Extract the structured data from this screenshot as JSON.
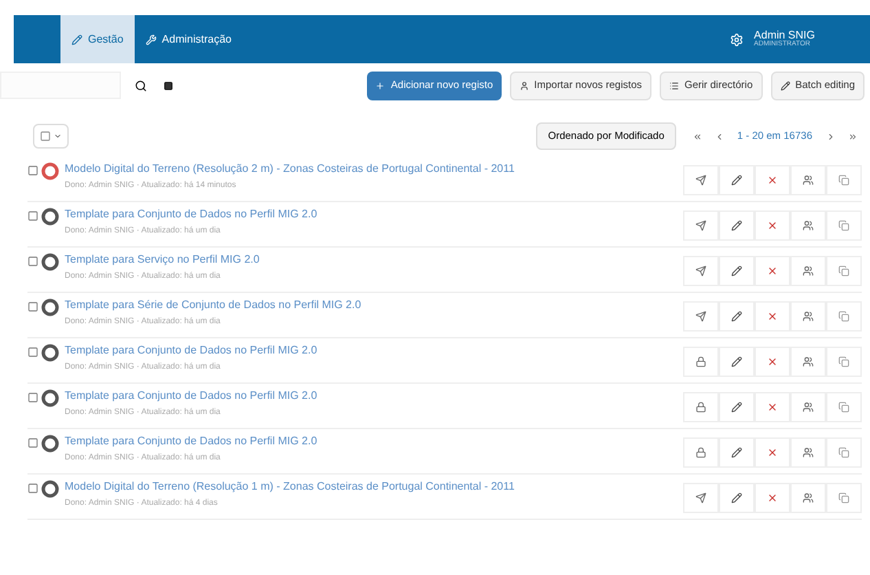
{
  "nav": {
    "tabs": [
      {
        "label": "Gestão",
        "selected": true
      },
      {
        "label": "Administração",
        "selected": false
      }
    ],
    "user": {
      "name": "Admin SNIG",
      "role": "ADMINISTRATOR"
    }
  },
  "toolbar": {
    "buttons": [
      {
        "label": "Adicionar novo registo",
        "kind": "primary"
      },
      {
        "label": "Importar novos registos",
        "kind": "import"
      },
      {
        "label": "Gerir directório",
        "kind": "directory"
      },
      {
        "label": "Batch editing",
        "kind": "edit"
      }
    ]
  },
  "list_header": {
    "sort": "Ordenado por Modificado",
    "range": "1 - 20 em 16736"
  },
  "records": [
    {
      "title": "Modelo Digital do Terreno (Resolução 2 m) - Zonas Costeiras de Portugal Continental - 2011",
      "meta": "Dono: Admin SNIG · Atualizado: há 14 minutos",
      "color": "#d9534f",
      "published": true,
      "checked": false
    },
    {
      "title": "Template para Conjunto de Dados no Perfil MIG 2.0",
      "meta": "Dono: Admin SNIG · Atualizado: há um dia",
      "color": "#555555",
      "published": true,
      "checked": false
    },
    {
      "title": "Template para Serviço no Perfil MIG 2.0",
      "meta": "Dono: Admin SNIG · Atualizado: há um dia",
      "color": "#555555",
      "published": true,
      "checked": false
    },
    {
      "title": "Template para Série de Conjunto de Dados no Perfil MIG 2.0",
      "meta": "Dono: Admin SNIG · Atualizado: há um dia",
      "color": "#555555",
      "published": true,
      "checked": false
    },
    {
      "title": "Template para Conjunto de Dados no Perfil MIG 2.0",
      "meta": "Dono: Admin SNIG · Atualizado: há um dia",
      "color": "#555555",
      "published": false,
      "checked": false
    },
    {
      "title": "Template para Conjunto de Dados no Perfil MIG 2.0",
      "meta": "Dono: Admin SNIG · Atualizado: há um dia",
      "color": "#555555",
      "published": false,
      "checked": false
    },
    {
      "title": "Template para Conjunto de Dados no Perfil MIG 2.0",
      "meta": "Dono: Admin SNIG · Atualizado: há um dia",
      "color": "#555555",
      "published": false,
      "checked": false
    },
    {
      "title": "Modelo Digital do Terreno (Resolução 1 m) - Zonas Costeiras de Portugal Continental - 2011",
      "meta": "Dono: Admin SNIG · Atualizado: há 4 dias",
      "color": "#555555",
      "published": true,
      "checked": false
    }
  ]
}
